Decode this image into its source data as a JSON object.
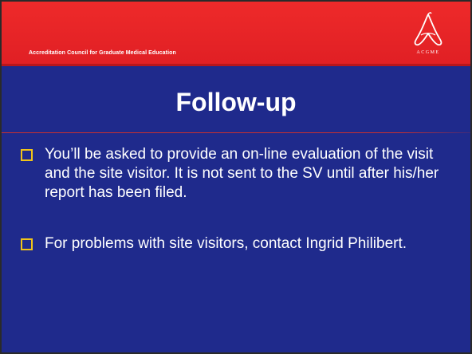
{
  "header": {
    "organization": "Accreditation Council for Graduate Medical Education",
    "logo_text": "ACGME"
  },
  "slide": {
    "title": "Follow-up",
    "bullets": [
      {
        "text": "You’ll be asked to provide an on-line evaluation of the visit and the site visitor.  It is not sent to the SV until after his/her report has been filed."
      },
      {
        "text": "For problems with site visitors, contact Ingrid Philibert."
      }
    ]
  },
  "colors": {
    "background": "#1f2a8c",
    "header_band": "#e01f24",
    "bullet_box": "#f0c419",
    "text": "#ffffff"
  },
  "icons": {
    "logo": "acgme-logo-icon",
    "bullet": "square-bullet-icon"
  }
}
